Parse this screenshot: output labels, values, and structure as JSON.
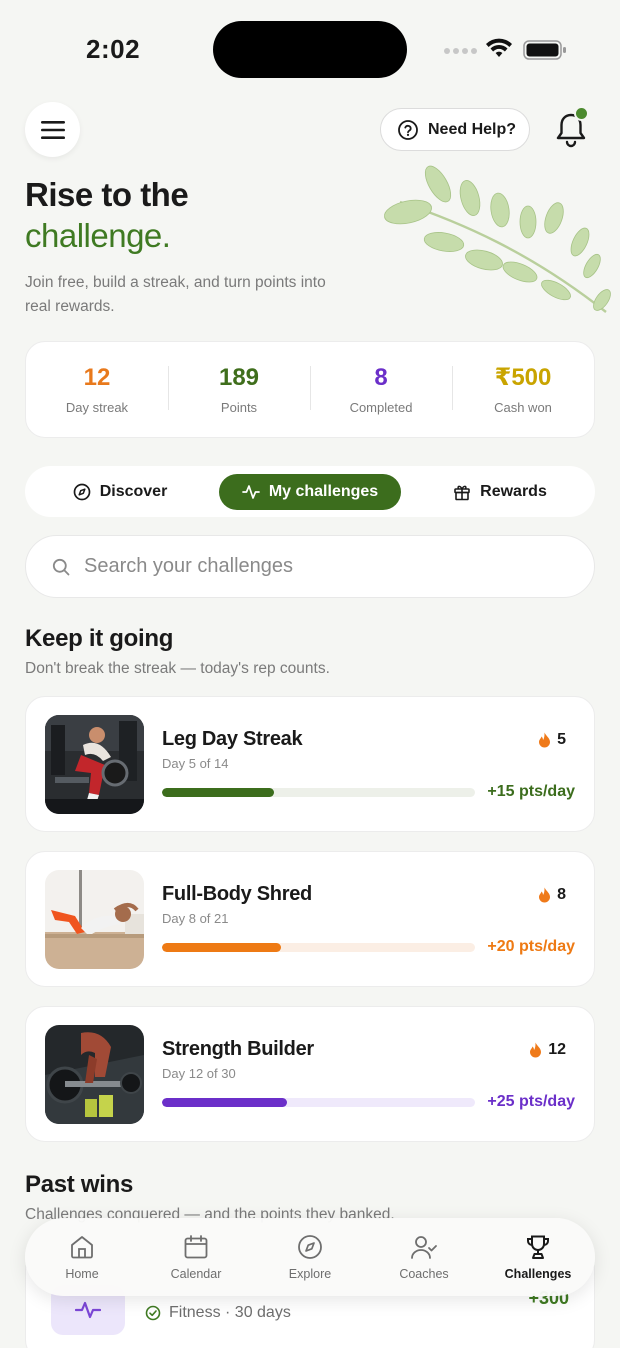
{
  "status_bar": {
    "time": "2:02"
  },
  "header": {
    "help_label": "Need Help?"
  },
  "hero": {
    "title_line1": "Rise to the",
    "title_line2": "challenge.",
    "subtitle": "Join free, build a streak, and turn points into real rewards."
  },
  "stats": [
    {
      "value": "12",
      "label": "Day streak",
      "color": "#e8791c"
    },
    {
      "value": "189",
      "label": "Points",
      "color": "#3f6e1c"
    },
    {
      "value": "8",
      "label": "Completed",
      "color": "#6b2fc9"
    },
    {
      "value": "₹500",
      "label": "Cash won",
      "color": "#c9a400"
    }
  ],
  "tabs": [
    {
      "label": "Discover",
      "icon": "compass-icon"
    },
    {
      "label": "My challenges",
      "icon": "activity-icon",
      "active": true
    },
    {
      "label": "Rewards",
      "icon": "gift-icon"
    }
  ],
  "search": {
    "placeholder": "Search your challenges"
  },
  "keep_going": {
    "title": "Keep it going",
    "subtitle": "Don't break the streak — today's rep counts."
  },
  "challenges": [
    {
      "name": "Leg Day Streak",
      "day": "Day 5 of 14",
      "streak": "5",
      "points": "+15 pts/day",
      "progress": 0.357,
      "color": "#3c6d1d",
      "track": "#edf0e9"
    },
    {
      "name": "Full-Body Shred",
      "day": "Day 8 of 21",
      "streak": "8",
      "points": "+20 pts/day",
      "progress": 0.381,
      "color": "#ee7a14",
      "track": "#fbeee4"
    },
    {
      "name": "Strength Builder",
      "day": "Day 12 of 30",
      "streak": "12",
      "points": "+25 pts/day",
      "progress": 0.4,
      "color": "#6b2fc9",
      "track": "#efe9fb"
    }
  ],
  "past_wins": {
    "title": "Past wins",
    "subtitle": "Challenges conquered — and the points they banked.",
    "item": {
      "meta": "Fitness · 30 days",
      "points": "+300"
    }
  },
  "nav": [
    {
      "label": "Home",
      "icon": "home-icon"
    },
    {
      "label": "Calendar",
      "icon": "calendar-icon"
    },
    {
      "label": "Explore",
      "icon": "compass-icon"
    },
    {
      "label": "Coaches",
      "icon": "user-check-icon"
    },
    {
      "label": "Challenges",
      "icon": "trophy-icon",
      "active": true
    }
  ]
}
